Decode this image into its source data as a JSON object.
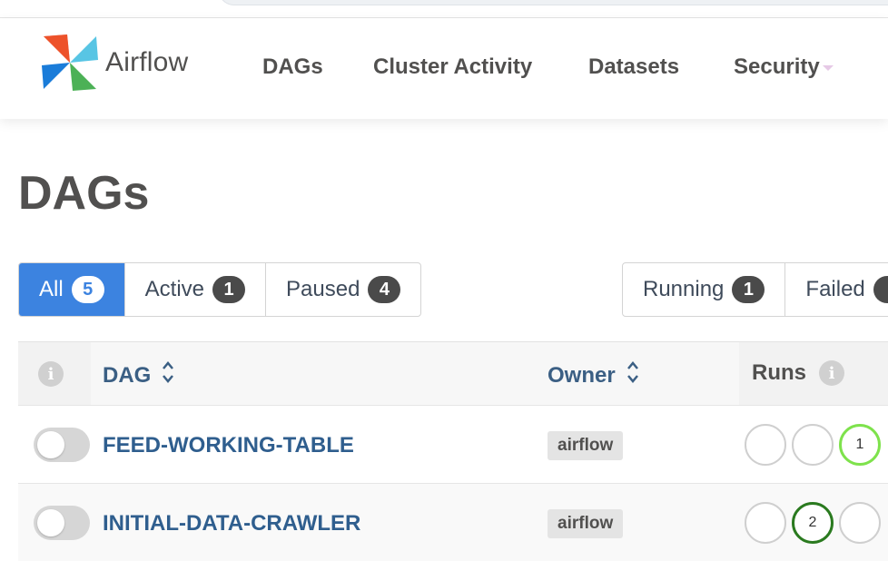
{
  "app": {
    "name": "Airflow"
  },
  "nav": {
    "items": [
      {
        "label": "DAGs"
      },
      {
        "label": "Cluster Activity"
      },
      {
        "label": "Datasets"
      },
      {
        "label": "Security"
      }
    ]
  },
  "page": {
    "title": "DAGs"
  },
  "filters": {
    "status": [
      {
        "label": "All",
        "count": "5"
      },
      {
        "label": "Active",
        "count": "1"
      },
      {
        "label": "Paused",
        "count": "4"
      }
    ],
    "runs": [
      {
        "label": "Running",
        "count": "1"
      },
      {
        "label": "Failed",
        "count": ""
      }
    ]
  },
  "table": {
    "columns": {
      "dag": "DAG",
      "owner": "Owner",
      "runs": "Runs"
    },
    "rows": [
      {
        "dag_id": "FEED-WORKING-TABLE",
        "owner": "airflow",
        "runs": [
          "",
          "",
          "1"
        ],
        "paused": true
      },
      {
        "dag_id": "INITIAL-DATA-CRAWLER",
        "owner": "airflow",
        "runs": [
          "",
          "2",
          ""
        ],
        "paused": true
      }
    ]
  },
  "colors": {
    "accent": "#3c83e0",
    "link": "#2f5e8e",
    "running": "#7ee24c",
    "success": "#2a7a1f",
    "failed": "#c93a2a"
  }
}
